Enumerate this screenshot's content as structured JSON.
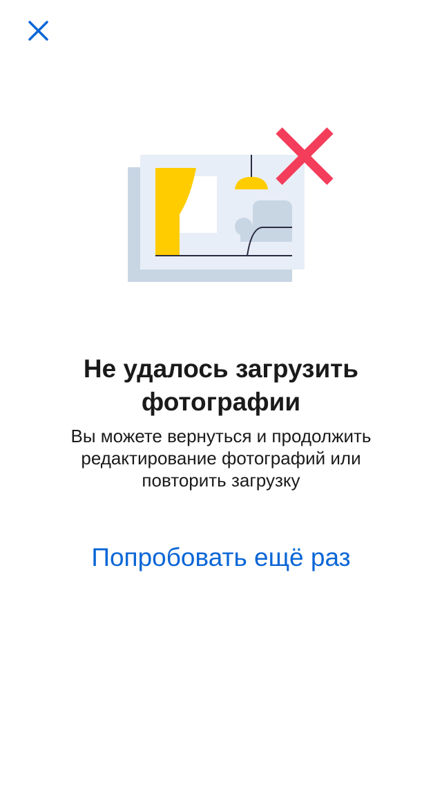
{
  "colors": {
    "accent": "#0a66d6",
    "text": "#1a1a1a",
    "error": "#f33d5a",
    "illustration_yellow": "#ffcc00",
    "illustration_blue_light": "#e8eef7",
    "illustration_blue_dark": "#c8d6e4"
  },
  "header": {
    "close_icon": "close-icon"
  },
  "illustration": {
    "icon": "photo-upload-failed-illustration"
  },
  "message": {
    "title": "Не удалось загрузить фотографии",
    "description": "Вы можете вернуться и продолжить редактирование фотографий или повторить загрузку"
  },
  "actions": {
    "retry_label": "Попробовать ещё раз"
  }
}
